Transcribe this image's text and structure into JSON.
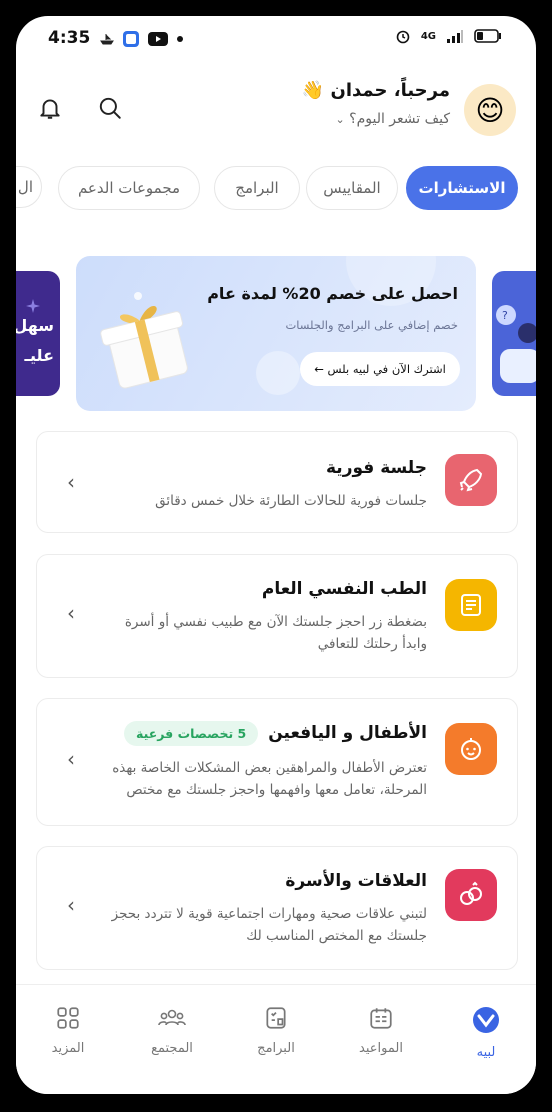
{
  "status": {
    "time": "4:35",
    "network": "4G"
  },
  "header": {
    "greeting": "مرحباً، حمدان 👋",
    "mood_prompt": "كيف تشعر اليوم؟",
    "avatar_emoji": "😊"
  },
  "tabs": [
    {
      "label": "الاستشارات",
      "active": true
    },
    {
      "label": "المقاييس",
      "active": false
    },
    {
      "label": "البرامج",
      "active": false
    },
    {
      "label": "مجموعات الدعم",
      "active": false
    },
    {
      "label": "ال",
      "active": false
    }
  ],
  "banner": {
    "title": "احصل على خصم 20% لمدة عام",
    "subtitle": "خصم إضافي على البرامج والجلسات",
    "cta": "اشترك الآن في لبيه بلس ←"
  },
  "side_banner_text": {
    "line1": "سهل",
    "line2": "عليـ"
  },
  "services": [
    {
      "title": "جلسة فورية",
      "desc": "جلسات فورية للحالات الطارئة خلال خمس دقائق",
      "icon": "rocket-icon",
      "color": "#e8656f",
      "badge": ""
    },
    {
      "title": "الطب النفسي العام",
      "desc": "بضغطة زر احجز جلستك الآن مع طبيب نفسي أو أسرة وابدأ رحلتك للتعافي",
      "icon": "clipboard-icon",
      "color": "#f5b600",
      "badge": ""
    },
    {
      "title": "الأطفال و اليافعين",
      "desc": "تعترض الأطفال والمراهقين بعض المشكلات الخاصة بهذه المرحلة، تعامل معها وافهمها واحجز جلستك مع مختص",
      "icon": "child-face-icon",
      "color": "#f47b2b",
      "badge": "5 تخصصات فرعية"
    },
    {
      "title": "العلاقات والأسرة",
      "desc": "لتبني علاقات صحية ومهارات اجتماعية قوية لا تتردد بحجز جلستك مع المختص المناسب لك",
      "icon": "rings-icon",
      "color": "#e23a5d",
      "badge": ""
    }
  ],
  "bottom_nav": [
    {
      "label": "لبيه",
      "icon": "labbeh-logo-icon",
      "active": true
    },
    {
      "label": "المواعيد",
      "icon": "calendar-icon",
      "active": false
    },
    {
      "label": "البرامج",
      "icon": "programs-icon",
      "active": false
    },
    {
      "label": "المجتمع",
      "icon": "community-icon",
      "active": false
    },
    {
      "label": "المزيد",
      "icon": "grid-icon",
      "active": false
    }
  ]
}
